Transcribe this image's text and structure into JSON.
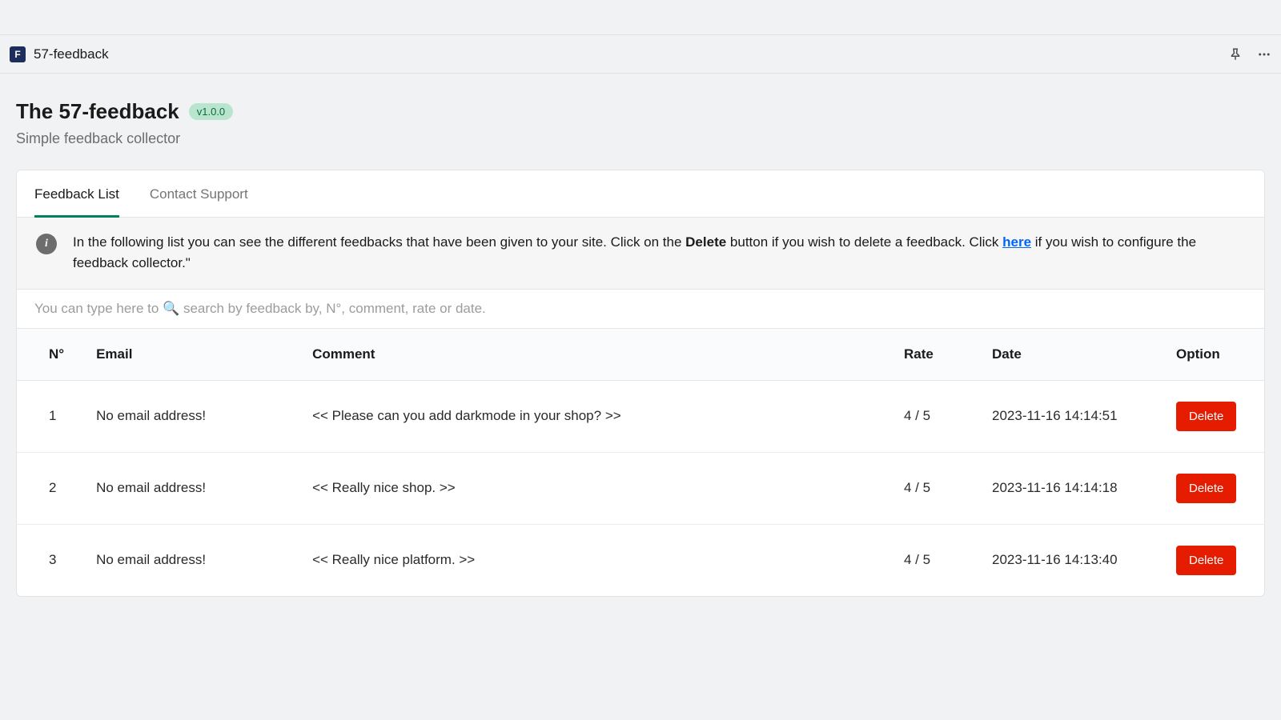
{
  "titlebar": {
    "badge_letter": "F",
    "title": "57-feedback"
  },
  "header": {
    "title": "The 57-feedback",
    "version": "v1.0.0",
    "subtitle": "Simple feedback collector"
  },
  "tabs": [
    {
      "label": "Feedback List",
      "active": true
    },
    {
      "label": "Contact Support",
      "active": false
    }
  ],
  "banner": {
    "pre": "In the following list you can see the different feedbacks that have been given to your site. Click on the ",
    "bold": "Delete",
    "mid": " button if you wish to delete a feedback. Click ",
    "link": "here",
    "post": " if you wish to configure the feedback collector.\""
  },
  "search": {
    "placeholder": "You can type here to 🔍 search by feedback by, N°, comment, rate or date."
  },
  "table": {
    "headers": [
      "N°",
      "Email",
      "Comment",
      "Rate",
      "Date",
      "Option"
    ],
    "delete_label": "Delete",
    "rows": [
      {
        "n": "1",
        "email": "No email address!",
        "comment": "<< Please can you add darkmode in your shop? >>",
        "rate": "4 / 5",
        "date": "2023-11-16 14:14:51"
      },
      {
        "n": "2",
        "email": "No email address!",
        "comment": "<< Really nice shop. >>",
        "rate": "4 / 5",
        "date": "2023-11-16 14:14:18"
      },
      {
        "n": "3",
        "email": "No email address!",
        "comment": "<< Really nice platform. >>",
        "rate": "4 / 5",
        "date": "2023-11-16 14:13:40"
      }
    ]
  }
}
